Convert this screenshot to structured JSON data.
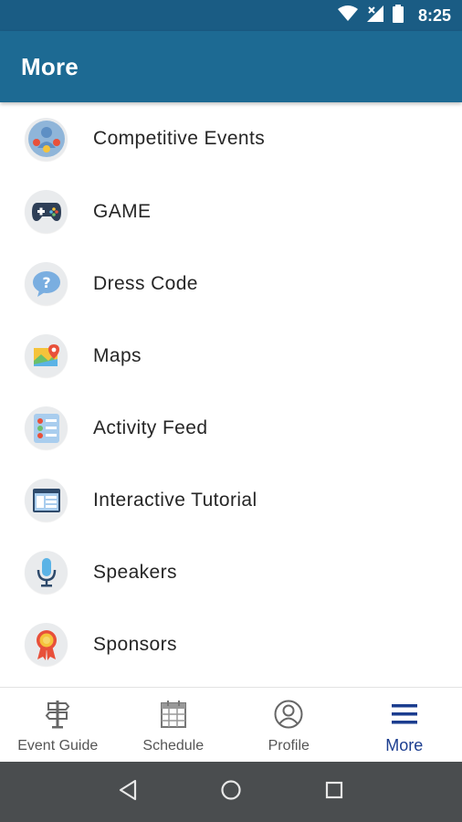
{
  "status_bar": {
    "time": "8:25"
  },
  "header": {
    "title": "More"
  },
  "menu": {
    "items": [
      {
        "label": "Competitive Events",
        "icon": "people-medal-icon"
      },
      {
        "label": "GAME",
        "icon": "gamepad-icon"
      },
      {
        "label": "Dress Code",
        "icon": "question-bubble-icon"
      },
      {
        "label": "Maps",
        "icon": "map-pin-icon"
      },
      {
        "label": "Activity Feed",
        "icon": "activity-list-icon"
      },
      {
        "label": "Interactive Tutorial",
        "icon": "tutorial-window-icon"
      },
      {
        "label": "Speakers",
        "icon": "microphone-icon"
      },
      {
        "label": "Sponsors",
        "icon": "ribbon-award-icon"
      }
    ]
  },
  "bottom_nav": {
    "tabs": [
      {
        "label": "Event Guide",
        "icon": "signpost-icon"
      },
      {
        "label": "Schedule",
        "icon": "calendar-icon"
      },
      {
        "label": "Profile",
        "icon": "profile-icon"
      },
      {
        "label": "More",
        "icon": "hamburger-menu-icon",
        "active": true
      }
    ]
  },
  "colors": {
    "status_bar": "#1a5c84",
    "app_bar": "#1d6a93",
    "active_tab": "#1b3d8f",
    "system_nav": "#4a4d4f"
  }
}
